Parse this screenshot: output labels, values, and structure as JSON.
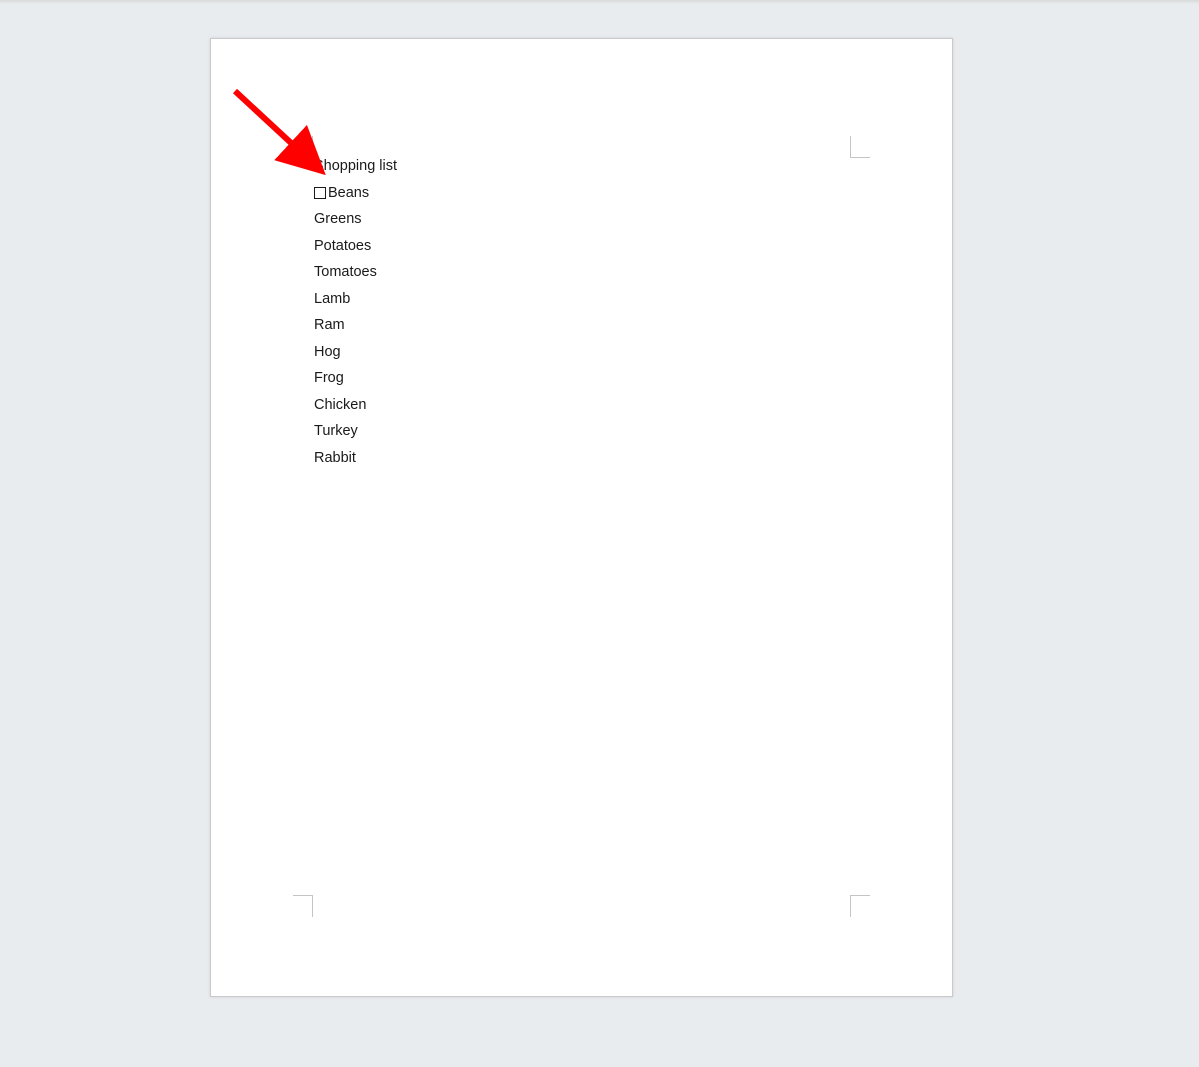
{
  "document": {
    "title": "Shopping list",
    "items": [
      {
        "label": "Beans",
        "has_checkbox": true
      },
      {
        "label": "Greens",
        "has_checkbox": false
      },
      {
        "label": "Potatoes",
        "has_checkbox": false
      },
      {
        "label": "Tomatoes",
        "has_checkbox": false
      },
      {
        "label": "Lamb",
        "has_checkbox": false
      },
      {
        "label": "Ram",
        "has_checkbox": false
      },
      {
        "label": "Hog",
        "has_checkbox": false
      },
      {
        "label": "Frog",
        "has_checkbox": false
      },
      {
        "label": "Chicken",
        "has_checkbox": false
      },
      {
        "label": "Turkey",
        "has_checkbox": false
      },
      {
        "label": "Rabbit",
        "has_checkbox": false
      }
    ]
  },
  "annotation": {
    "arrow_color": "#ff0000"
  }
}
